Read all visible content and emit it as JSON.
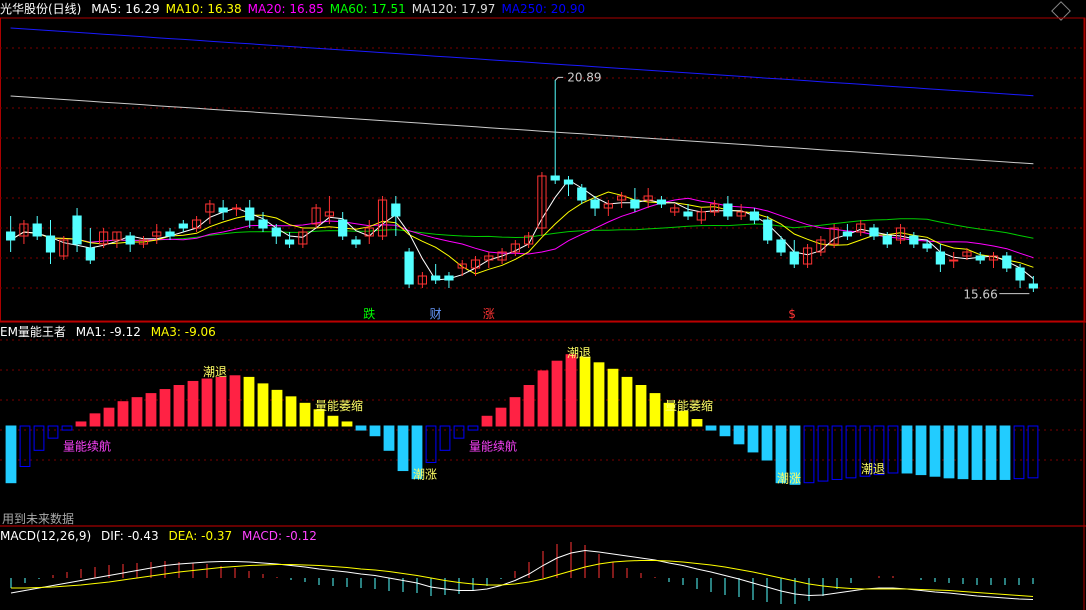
{
  "main": {
    "title": "光华股份(日线)",
    "ma_labels": [
      {
        "label": "MA5: 16.29",
        "color": "#ffffff"
      },
      {
        "label": "MA10: 16.38",
        "color": "#ffff00"
      },
      {
        "label": "MA20: 16.85",
        "color": "#ff00ff"
      },
      {
        "label": "MA60: 17.51",
        "color": "#00ff00"
      },
      {
        "label": "MA120: 17.97",
        "color": "#dddddd"
      },
      {
        "label": "MA250: 20.90",
        "color": "#0000ff"
      }
    ],
    "high_label": "20.89",
    "low_label": "15.66",
    "signals": [
      {
        "text": "跌",
        "color": "#00ff00",
        "idx": 27
      },
      {
        "text": "财",
        "color": "#6699ff",
        "idx": 32
      },
      {
        "text": "涨",
        "color": "#ff3333",
        "idx": 36
      },
      {
        "text": "$",
        "color": "#ff3333",
        "idx": 59
      }
    ]
  },
  "em": {
    "title": "EM量能王者",
    "ma1": "MA1: -9.12",
    "ma3": "MA3: -9.06",
    "notes": [
      {
        "text": "潮退",
        "color": "#ffff66",
        "idx": 14,
        "val": 62
      },
      {
        "text": "量能续航",
        "color": "#ff44ff",
        "idx": 4,
        "val": -30
      },
      {
        "text": "量能萎缩",
        "color": "#ffff66",
        "idx": 22,
        "val": 20
      },
      {
        "text": "潮涨",
        "color": "#ffff66",
        "idx": 29,
        "val": -65
      },
      {
        "text": "潮退",
        "color": "#ffff66",
        "idx": 40,
        "val": 85
      },
      {
        "text": "量能续航",
        "color": "#ff44ff",
        "idx": 33,
        "val": -30
      },
      {
        "text": "量能萎缩",
        "color": "#ffff66",
        "idx": 47,
        "val": 20
      },
      {
        "text": "潮涨",
        "color": "#ffff66",
        "idx": 55,
        "val": -70
      },
      {
        "text": "潮退",
        "color": "#ffff66",
        "idx": 61,
        "val": -58
      }
    ],
    "future_note": "用到未来数据"
  },
  "macd": {
    "title": "MACD(12,26,9)",
    "dif": "DIF: -0.43",
    "dea": "DEA: -0.37",
    "macd": "MACD: -0.12"
  },
  "colors": {
    "up": "#ff3333",
    "down": "#54ffff",
    "bg": "#000000",
    "grid": "#7a0000"
  },
  "chart_data": [
    {
      "type": "candlestick",
      "ylim": [
        15.4,
        22.4
      ],
      "candles": [
        [
          17.1,
          17.5,
          16.6,
          16.9
        ],
        [
          17.0,
          17.4,
          16.8,
          17.3
        ],
        [
          17.3,
          17.5,
          16.9,
          17.0
        ],
        [
          17.0,
          17.4,
          16.3,
          16.6
        ],
        [
          16.5,
          17.0,
          16.4,
          16.9
        ],
        [
          17.5,
          17.7,
          16.6,
          16.8
        ],
        [
          16.7,
          17.2,
          16.3,
          16.4
        ],
        [
          16.8,
          17.2,
          16.7,
          17.1
        ],
        [
          16.9,
          17.1,
          16.7,
          17.1
        ],
        [
          17.0,
          17.1,
          16.6,
          16.8
        ],
        [
          16.8,
          17.0,
          16.7,
          16.9
        ],
        [
          17.0,
          17.3,
          16.8,
          17.1
        ],
        [
          17.1,
          17.2,
          16.9,
          17.0
        ],
        [
          17.3,
          17.4,
          17.1,
          17.2
        ],
        [
          17.2,
          17.5,
          17.1,
          17.4
        ],
        [
          17.6,
          17.9,
          17.3,
          17.8
        ],
        [
          17.7,
          17.9,
          17.4,
          17.6
        ],
        [
          17.7,
          17.8,
          17.5,
          17.7
        ],
        [
          17.7,
          17.9,
          17.2,
          17.4
        ],
        [
          17.4,
          17.6,
          17.1,
          17.2
        ],
        [
          17.2,
          17.3,
          16.8,
          17.0
        ],
        [
          16.9,
          17.1,
          16.7,
          16.8
        ],
        [
          16.8,
          17.2,
          16.7,
          17.1
        ],
        [
          17.3,
          17.8,
          17.2,
          17.7
        ],
        [
          17.5,
          18.0,
          17.3,
          17.6
        ],
        [
          17.4,
          17.6,
          16.9,
          17.0
        ],
        [
          16.9,
          17.0,
          16.7,
          16.8
        ],
        [
          17.0,
          17.4,
          16.8,
          17.2
        ],
        [
          17.0,
          18.0,
          16.9,
          17.9
        ],
        [
          17.8,
          18.0,
          17.0,
          17.5
        ],
        [
          16.6,
          16.7,
          15.7,
          15.8
        ],
        [
          15.8,
          16.1,
          15.7,
          16.0
        ],
        [
          16.0,
          16.3,
          15.8,
          15.9
        ],
        [
          16.0,
          16.1,
          15.7,
          15.9
        ],
        [
          16.2,
          16.4,
          16.0,
          16.3
        ],
        [
          16.2,
          16.5,
          16.0,
          16.4
        ],
        [
          16.4,
          16.6,
          16.2,
          16.5
        ],
        [
          16.4,
          16.7,
          16.3,
          16.6
        ],
        [
          16.6,
          16.9,
          16.5,
          16.8
        ],
        [
          16.8,
          17.1,
          16.7,
          17.0
        ],
        [
          17.2,
          18.6,
          17.0,
          18.5
        ],
        [
          18.5,
          20.9,
          18.3,
          18.4
        ],
        [
          18.4,
          18.5,
          18.0,
          18.3
        ],
        [
          18.2,
          18.3,
          17.8,
          17.9
        ],
        [
          17.9,
          18.0,
          17.5,
          17.7
        ],
        [
          17.7,
          17.9,
          17.5,
          17.8
        ],
        [
          17.9,
          18.1,
          17.7,
          18.0
        ],
        [
          17.9,
          18.2,
          17.6,
          17.7
        ],
        [
          17.9,
          18.2,
          17.7,
          18.0
        ],
        [
          17.9,
          18.0,
          17.7,
          17.8
        ],
        [
          17.6,
          17.8,
          17.5,
          17.7
        ],
        [
          17.6,
          17.8,
          17.4,
          17.5
        ],
        [
          17.4,
          17.7,
          17.3,
          17.6
        ],
        [
          17.6,
          17.9,
          17.5,
          17.8
        ],
        [
          17.8,
          18.0,
          17.4,
          17.5
        ],
        [
          17.5,
          17.8,
          17.4,
          17.6
        ],
        [
          17.6,
          17.7,
          17.3,
          17.4
        ],
        [
          17.4,
          17.5,
          16.8,
          16.9
        ],
        [
          16.9,
          17.0,
          16.5,
          16.6
        ],
        [
          16.6,
          16.9,
          16.2,
          16.3
        ],
        [
          16.3,
          16.8,
          16.2,
          16.7
        ],
        [
          16.6,
          17.0,
          16.5,
          16.9
        ],
        [
          16.8,
          17.3,
          16.7,
          17.2
        ],
        [
          17.1,
          17.3,
          16.9,
          17.0
        ],
        [
          17.1,
          17.4,
          17.0,
          17.3
        ],
        [
          17.2,
          17.3,
          16.9,
          17.0
        ],
        [
          17.0,
          17.1,
          16.7,
          16.8
        ],
        [
          16.9,
          17.3,
          16.8,
          17.2
        ],
        [
          17.0,
          17.1,
          16.7,
          16.8
        ],
        [
          16.8,
          16.9,
          16.6,
          16.7
        ],
        [
          16.6,
          16.8,
          16.1,
          16.3
        ],
        [
          16.4,
          16.6,
          16.2,
          16.4
        ],
        [
          16.5,
          16.7,
          16.4,
          16.6
        ],
        [
          16.5,
          16.6,
          16.3,
          16.4
        ],
        [
          16.4,
          16.6,
          16.2,
          16.5
        ],
        [
          16.5,
          16.6,
          16.1,
          16.2
        ],
        [
          16.2,
          16.3,
          15.7,
          15.9
        ],
        [
          15.8,
          16.0,
          15.6,
          15.7
        ]
      ],
      "high_marker": 20.89,
      "low_marker": 15.66
    },
    {
      "type": "bar",
      "name": "EM量能王者",
      "ylim": [
        -100,
        100
      ],
      "values": [
        -70,
        -50,
        -30,
        -15,
        -5,
        5,
        15,
        22,
        30,
        35,
        40,
        45,
        50,
        55,
        58,
        60,
        62,
        60,
        52,
        44,
        36,
        28,
        20,
        12,
        5,
        -5,
        -12,
        -30,
        -55,
        -65,
        -45,
        -30,
        -15,
        -5,
        12,
        22,
        35,
        50,
        68,
        80,
        88,
        85,
        78,
        70,
        60,
        50,
        40,
        28,
        18,
        8,
        -5,
        -12,
        -22,
        -32,
        -42,
        -70,
        -72,
        -70,
        -68,
        -66,
        -64,
        -62,
        -60,
        -58,
        -58,
        -60,
        -62,
        -64,
        -65,
        -66,
        -66,
        -66,
        -65,
        -64
      ]
    },
    {
      "type": "line",
      "name": "MACD",
      "ylim": [
        -0.8,
        0.8
      ],
      "dif": [
        -0.3,
        -0.25,
        -0.2,
        -0.15,
        -0.1,
        -0.05,
        0.0,
        0.05,
        0.1,
        0.15,
        0.2,
        0.25,
        0.28,
        0.3,
        0.32,
        0.33,
        0.33,
        0.32,
        0.3,
        0.28,
        0.25,
        0.22,
        0.18,
        0.15,
        0.12,
        0.08,
        0.05,
        0.0,
        -0.05,
        -0.1,
        -0.18,
        -0.22,
        -0.25,
        -0.25,
        -0.22,
        -0.15,
        -0.05,
        0.08,
        0.25,
        0.4,
        0.5,
        0.55,
        0.52,
        0.48,
        0.44,
        0.4,
        0.36,
        0.3,
        0.25,
        0.18,
        0.12,
        0.05,
        -0.02,
        -0.1,
        -0.18,
        -0.26,
        -0.32,
        -0.35,
        -0.34,
        -0.3,
        -0.26,
        -0.22,
        -0.2,
        -0.2,
        -0.22,
        -0.25,
        -0.28,
        -0.3,
        -0.33,
        -0.36,
        -0.38,
        -0.4,
        -0.42,
        -0.43
      ],
      "dea": [
        -0.2,
        -0.2,
        -0.19,
        -0.18,
        -0.16,
        -0.14,
        -0.11,
        -0.08,
        -0.04,
        0.0,
        0.04,
        0.08,
        0.12,
        0.15,
        0.18,
        0.21,
        0.23,
        0.25,
        0.26,
        0.27,
        0.27,
        0.26,
        0.25,
        0.23,
        0.21,
        0.18,
        0.16,
        0.13,
        0.09,
        0.05,
        0.0,
        -0.05,
        -0.09,
        -0.12,
        -0.14,
        -0.14,
        -0.12,
        -0.08,
        -0.02,
        0.06,
        0.14,
        0.22,
        0.28,
        0.32,
        0.34,
        0.35,
        0.35,
        0.34,
        0.32,
        0.29,
        0.26,
        0.22,
        0.17,
        0.12,
        0.06,
        0.0,
        -0.06,
        -0.12,
        -0.16,
        -0.19,
        -0.21,
        -0.22,
        -0.22,
        -0.22,
        -0.22,
        -0.23,
        -0.24,
        -0.25,
        -0.27,
        -0.29,
        -0.31,
        -0.33,
        -0.35,
        -0.37
      ]
    }
  ]
}
